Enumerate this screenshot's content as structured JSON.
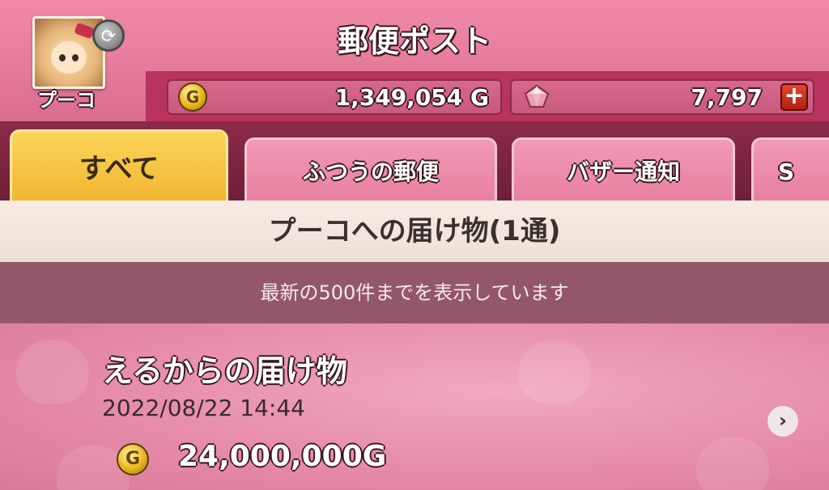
{
  "header": {
    "title": "郵便ポスト",
    "player_name": "プーコ",
    "gold_value": "1,349,054 G",
    "gem_value": "7,797",
    "plus_label": "+",
    "coin_symbol": "G",
    "switch_symbol": "⟳"
  },
  "tabs": [
    {
      "label": "すべて",
      "active": true
    },
    {
      "label": "ふつうの郵便",
      "active": false
    },
    {
      "label": "バザー通知",
      "active": false
    },
    {
      "label": "S",
      "active": false
    }
  ],
  "banner": {
    "heading": "プーコへの届け物(1通)",
    "notice": "最新の500件までを表示しています"
  },
  "mail": {
    "title": "えるからの届け物",
    "date": "2022/08/22 14:44",
    "amount": "24,000,000G",
    "chevron": "›"
  },
  "colors": {
    "accent_pink": "#e88aa5",
    "active_tab": "#fbd55a",
    "header_dark": "#8a2a47"
  },
  "icons": [
    "switch-icon",
    "gold-coin-icon",
    "gem-icon",
    "plus-icon",
    "chevron-right-icon"
  ]
}
